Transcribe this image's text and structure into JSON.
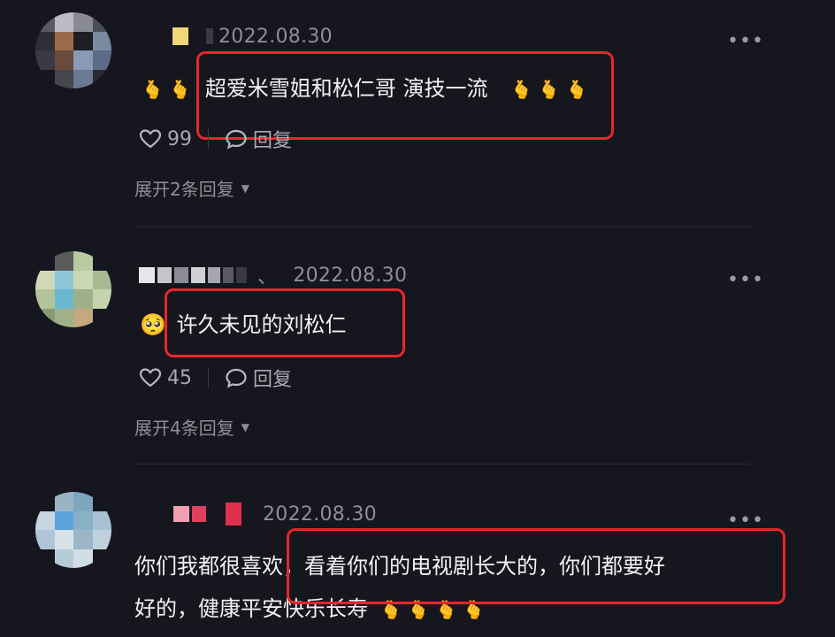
{
  "comments": [
    {
      "date": "2022.08.30",
      "text_prefix": "🫰 🫰",
      "text_main": "超爱米雪姐和松仁哥 演技一流",
      "text_suffix": "🫰 🫰 🫰",
      "likes": "99",
      "reply_label": "回复",
      "expand_label": "展开2条回复"
    },
    {
      "date": "2022.08.30",
      "separator": "、",
      "emoji": "🥺",
      "text_main": "许久未见的刘松仁",
      "likes": "45",
      "reply_label": "回复",
      "expand_label": "展开4条回复"
    },
    {
      "date": "2022.08.30",
      "text_line1": "你们我都很喜欢，看着你们的电视剧长大的，你们都要好",
      "text_line2": "好的，健康平安快乐长寿",
      "text_line2_suffix": "🫰 🫰 🫰 🫰"
    }
  ],
  "colors": {
    "background": "#16161e",
    "highlight_border": "#e8262b",
    "muted_text": "#8e8e96"
  }
}
